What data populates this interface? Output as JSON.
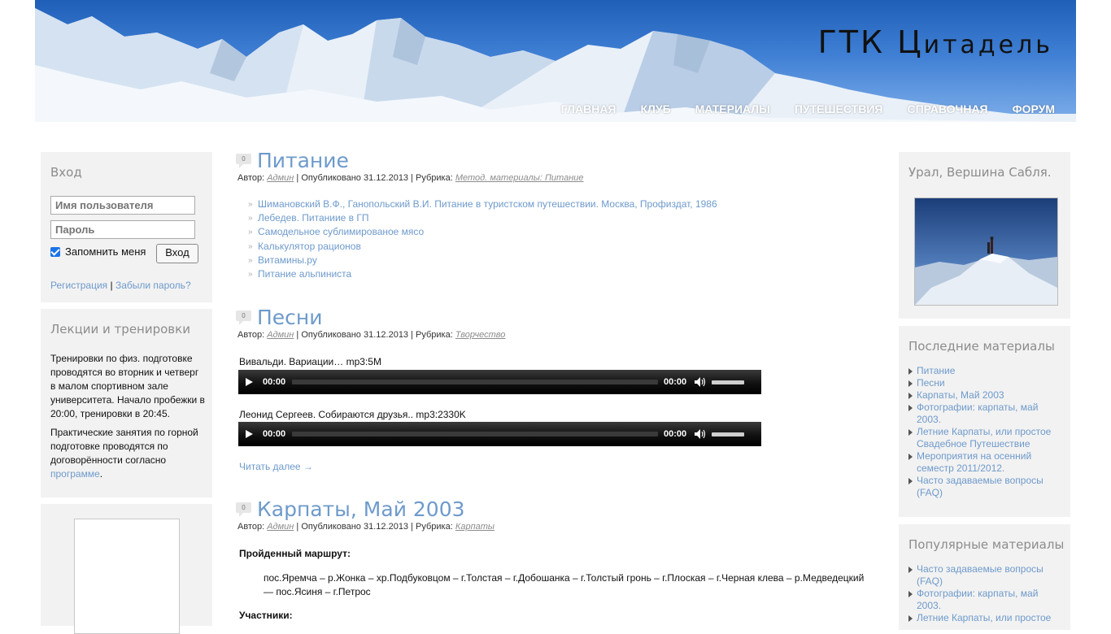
{
  "site": {
    "title_first": "ГТК Ц",
    "title_rest": "итадель",
    "nav": [
      "ГЛАВНАЯ",
      "КЛУБ",
      "МАТЕРИАЛЫ",
      "ПУТЕШЕСТВИЯ",
      "СПРАВОЧНАЯ",
      "ФОРУМ"
    ]
  },
  "login": {
    "title": "Вход",
    "username_placeholder": "Имя пользователя",
    "password_placeholder": "Пароль",
    "remember_label": "Запомнить меня",
    "remember_checked": true,
    "submit_label": "Вход",
    "register_link": "Регистрация",
    "separator": "|",
    "forgot_link": "Забыли пароль?"
  },
  "lectures": {
    "title": "Лекции и тренировки",
    "para1": "Тренировки по физ. подготовке проводятся во вторник и четверг в малом спортивном зале университета. Начало пробежки в 20:00, тренировки в 20:45.",
    "para2_text": "Практические занятия по горной подготовке проводятся по договорённости согласно ",
    "para2_link": "программе",
    "para2_end": "."
  },
  "photo_widget": {
    "title": "Урал, Вершина Сабля."
  },
  "latest": {
    "title": "Последние материалы",
    "items": [
      "Питание",
      "Песни",
      "Карпаты, Май 2003",
      "Фотографии: карпаты, май 2003.",
      "Летние Карпаты, или простое Свадебное Путешествие",
      "Мероприятия на осенний семестр 2011/2012.",
      "Часто задаваемые вопросы (FAQ)"
    ]
  },
  "popular": {
    "title": "Популярные материалы",
    "items": [
      "Часто задаваемые вопросы (FAQ)",
      "Фотографии: карпаты, май 2003.",
      "Летние Карпаты, или простое"
    ]
  },
  "meta_labels": {
    "author": "Автор:",
    "author_name": "Админ",
    "published": "| Опубликовано",
    "category": "| Рубрика:"
  },
  "posts": [
    {
      "comments": "0",
      "title": "Питание",
      "date": "31.12.2013",
      "category": "Метод. материалы: Питание",
      "links": [
        "Шимановский В.Ф., Ганопольский В.И. Питание в туристском путешествии. Москва, Профиздат, 1986",
        "Лебедев. Питаниие в ГП",
        "Самодельное сублимированое мясо",
        "Калькулятор рационов",
        "Витамины.ру",
        "Питание альпиниста"
      ]
    },
    {
      "comments": "0",
      "title": "Песни",
      "date": "31.12.2013",
      "category": "Творчество",
      "tracks": [
        {
          "label": "Вивальди. Вариации… mp3:5M",
          "current": "00:00",
          "duration": "00:00"
        },
        {
          "label": "Леонид Сергеев. Собираются друзья.. mp3:2330K",
          "current": "00:00",
          "duration": "00:00"
        }
      ],
      "read_more": "Читать далее →"
    },
    {
      "comments": "0",
      "title": "Карпаты, Май 2003",
      "date": "31.12.2013",
      "category": "Карпаты",
      "route_heading": "Пройденный маршрут:",
      "route": "пос.Яремча – р.Жонка – хр.Подбуковцом – г.Толстая – г.Добошанка – г.Толстый гронь – г.Плоская – г.Черная клева – р.Медведецкий — пос.Ясиня – г.Петрос",
      "participants_heading": "Участники:"
    }
  ]
}
